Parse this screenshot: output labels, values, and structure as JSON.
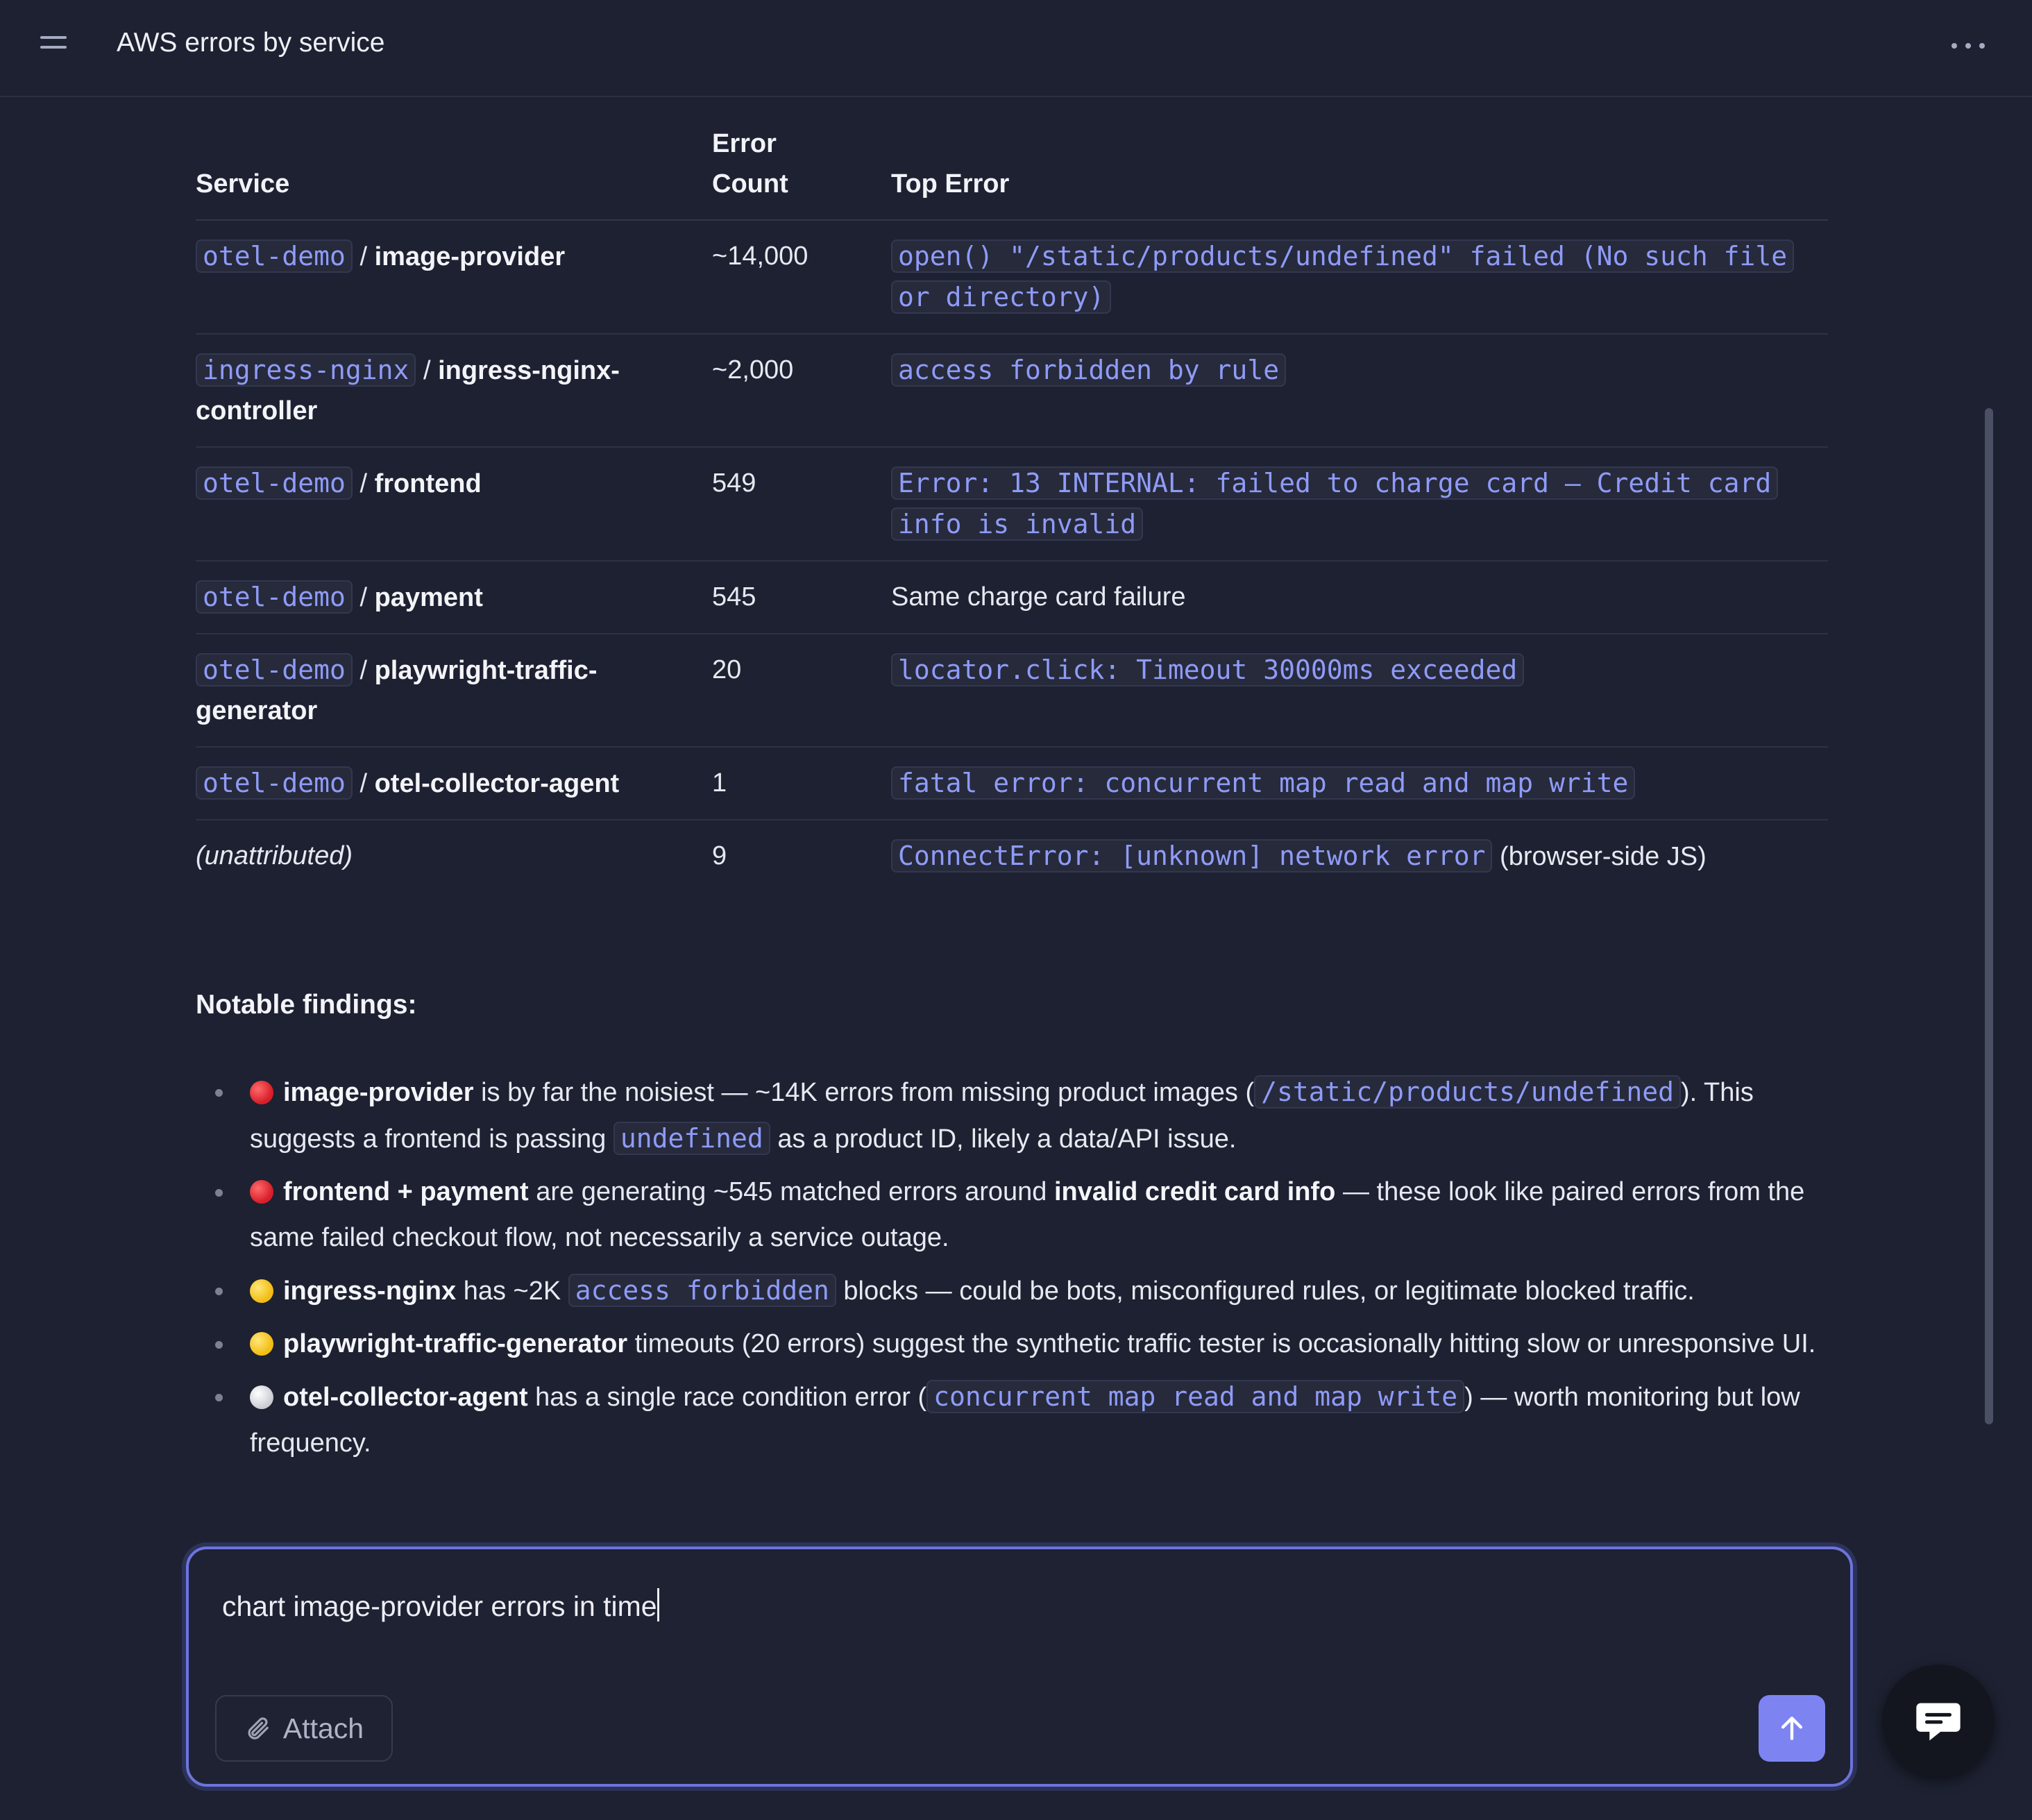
{
  "header": {
    "title": "AWS errors by service"
  },
  "table": {
    "headers": {
      "service": "Service",
      "count_line1": "Error",
      "count_line2": "Count",
      "top_error": "Top Error"
    },
    "rows": [
      {
        "namespace": "otel-demo",
        "sep": " / ",
        "service": "image-provider",
        "count": "~14,000",
        "error": "open() \"/static/products/undefined\" failed (No such file or directory)"
      },
      {
        "namespace": "ingress-nginx",
        "sep": " / ",
        "service": "ingress-nginx-controller",
        "count": "~2,000",
        "error": "access forbidden by rule"
      },
      {
        "namespace": "otel-demo",
        "sep": " / ",
        "service": "frontend",
        "count": "549",
        "error": "Error: 13 INTERNAL: failed to charge card — Credit card info is invalid"
      },
      {
        "namespace": "otel-demo",
        "sep": " / ",
        "service": "payment",
        "count": "545",
        "error_text": "Same charge card failure"
      },
      {
        "namespace": "otel-demo",
        "sep": " / ",
        "service": "playwright-traffic-generator",
        "count": "20",
        "error": "locator.click: Timeout 30000ms exceeded"
      },
      {
        "namespace": "otel-demo",
        "sep": " / ",
        "service": "otel-collector-agent",
        "count": "1",
        "error": "fatal error: concurrent map read and map write"
      },
      {
        "service_italic": "(unattributed)",
        "count": "9",
        "error": "ConnectError: [unknown] network error",
        "error_suffix": " (browser-side JS)"
      }
    ]
  },
  "findings": {
    "heading": "Notable findings:",
    "items": [
      {
        "severity": "red",
        "p1": "image-provider",
        "p2": " is by far the noisiest — ~14K errors from missing product images (",
        "c1": "/static/products/undefined",
        "p3": "). This suggests a frontend is passing ",
        "c2": "undefined",
        "p4": " as a product ID, likely a data/API issue."
      },
      {
        "severity": "red",
        "p1": "frontend + payment",
        "p2": " are generating ~545 matched errors around ",
        "b2": "invalid credit card info",
        "p3": " — these look like paired errors from the same failed checkout flow, not necessarily a service outage."
      },
      {
        "severity": "yellow",
        "p1": "ingress-nginx",
        "p2": " has ~2K ",
        "c1": "access forbidden",
        "p3": " blocks — could be bots, misconfigured rules, or legitimate blocked traffic."
      },
      {
        "severity": "yellow",
        "p1": "playwright-traffic-generator",
        "p2": " timeouts (20 errors) suggest the synthetic traffic tester is occasionally hitting slow or unresponsive UI."
      },
      {
        "severity": "white",
        "p1": "otel-collector-agent",
        "p2": " has a single race condition error (",
        "c1": "concurrent map read and map write",
        "p3": ") — worth monitoring but low frequency."
      }
    ]
  },
  "composer": {
    "text": "chart image-provider errors in time",
    "attach_label": "Attach"
  },
  "colors": {
    "accent": "#7d84f2",
    "code": "#8f9bf7",
    "background": "#1d2131"
  },
  "icons": {
    "menu": "menu-icon",
    "more": "more-dots-icon",
    "attach": "paperclip-icon",
    "send": "arrow-up-icon",
    "chat": "chat-bubble-icon"
  }
}
